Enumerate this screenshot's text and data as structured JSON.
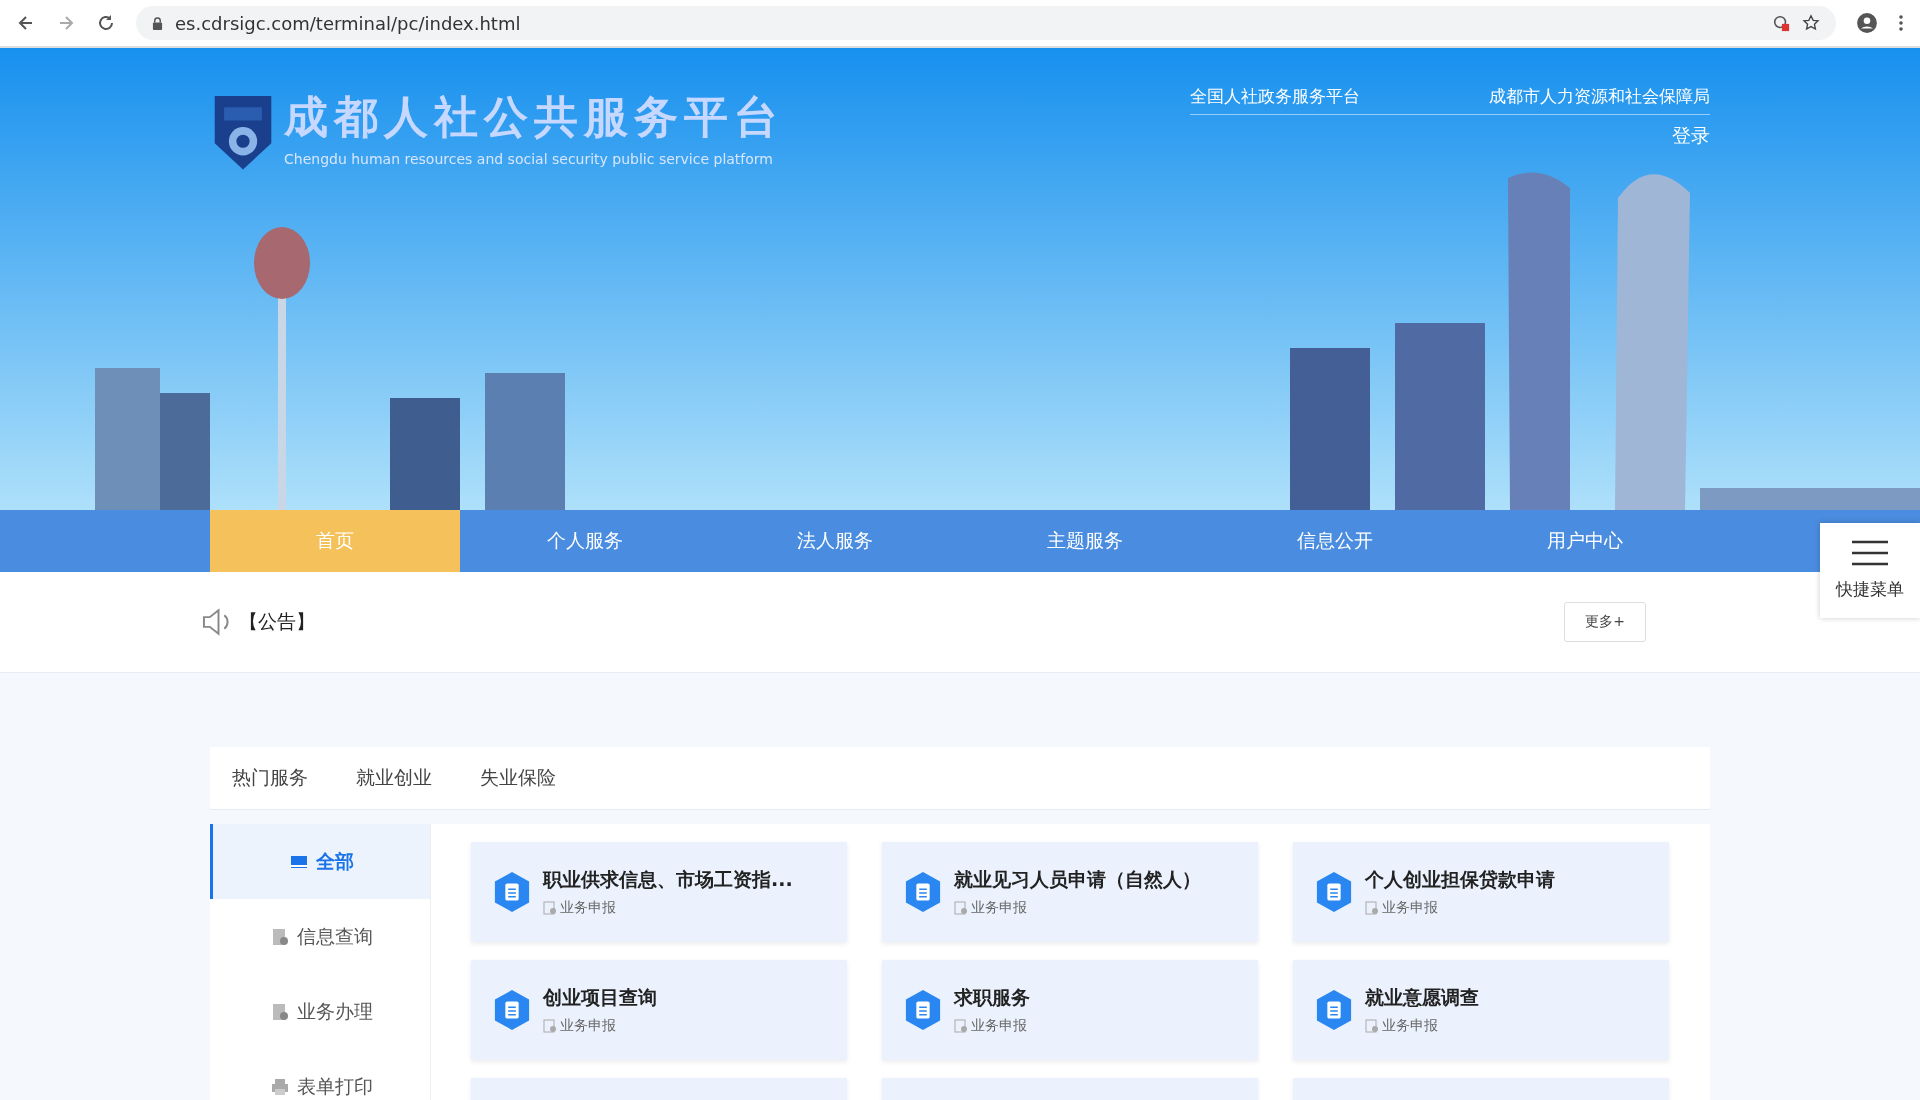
{
  "browser": {
    "url": "es.cdrsigc.com/terminal/pc/index.html"
  },
  "header": {
    "title": "成都人社公共服务平台",
    "subtitle": "Chengdu human resources and social security public service platform",
    "links": [
      "全国人社政务服务平台",
      "成都市人力资源和社会保障局"
    ],
    "login": "登录"
  },
  "nav": [
    {
      "label": "首页",
      "selected": true
    },
    {
      "label": "个人服务",
      "selected": false
    },
    {
      "label": "法人服务",
      "selected": false
    },
    {
      "label": "主题服务",
      "selected": false
    },
    {
      "label": "信息公开",
      "selected": false
    },
    {
      "label": "用户中心",
      "selected": false
    }
  ],
  "quick_menu": {
    "label": "快捷菜单"
  },
  "notice": {
    "label": "【公告】",
    "more": "更多+"
  },
  "service_tabs": [
    "热门服务",
    "就业创业",
    "失业保险"
  ],
  "categories": [
    {
      "label": "全部",
      "selected": true
    },
    {
      "label": "信息查询",
      "selected": false
    },
    {
      "label": "业务办理",
      "selected": false
    },
    {
      "label": "表单打印",
      "selected": false
    }
  ],
  "services": [
    {
      "title": "职业供求信息、市场工资指...",
      "tag": "业务申报"
    },
    {
      "title": "就业见习人员申请（自然人）",
      "tag": "业务申报"
    },
    {
      "title": "个人创业担保贷款申请",
      "tag": "业务申报"
    },
    {
      "title": "创业项目查询",
      "tag": "业务申报"
    },
    {
      "title": "求职服务",
      "tag": "业务申报"
    },
    {
      "title": "就业意愿调查",
      "tag": "业务申报"
    }
  ]
}
